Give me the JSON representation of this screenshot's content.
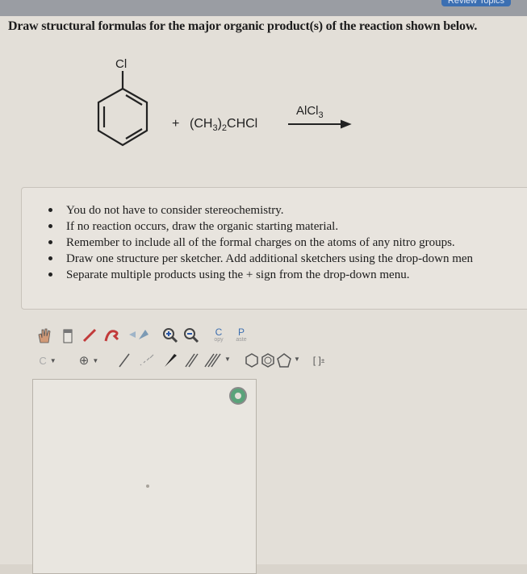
{
  "header": {
    "review_label": "Review Topics"
  },
  "question": {
    "title": "Draw structural formulas for the major organic product(s) of the reaction shown below.",
    "reactant_substituent": "Cl",
    "plus_sign": "+",
    "reagent_prefix": "(CH",
    "reagent_sub1": "3",
    "reagent_mid": ")",
    "reagent_sub2": "2",
    "reagent_suffix": "CHCl",
    "catalyst_prefix": "AlCl",
    "catalyst_sub": "3"
  },
  "instructions": [
    "You do not have to consider stereochemistry.",
    "If no reaction occurs, draw the organic starting material.",
    "Remember to include all of the formal charges on the atoms of any nitro groups.",
    "Draw one structure per sketcher. Add additional sketchers using the drop-down men",
    "Separate multiple products using the + sign from the drop-down menu."
  ],
  "toolbar": {
    "copy_label": "C",
    "copy_sub": "opy",
    "paste_label": "P",
    "paste_sub": "aste",
    "carbon_label": "C",
    "bracket_label": "[ ]",
    "bracket_sup": "±"
  }
}
